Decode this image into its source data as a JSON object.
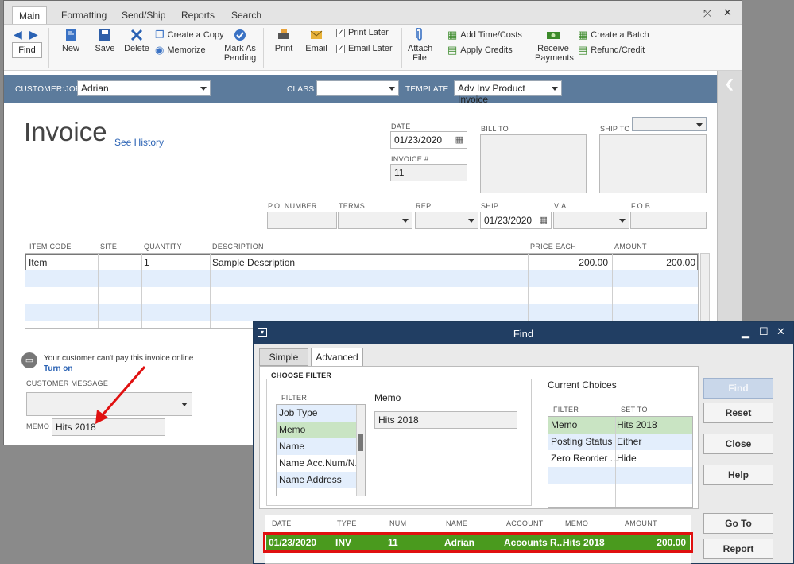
{
  "main": {
    "tabs": [
      "Main",
      "Formatting",
      "Send/Ship",
      "Reports",
      "Search"
    ],
    "ribbon": {
      "find": "Find",
      "new": "New",
      "save": "Save",
      "delete": "Delete",
      "create_copy": "Create a Copy",
      "memorize": "Memorize",
      "mark_as": "Mark As",
      "pending": "Pending",
      "print": "Print",
      "email": "Email",
      "print_later": "Print Later",
      "email_later": "Email Later",
      "attach": "Attach",
      "file": "File",
      "add_time_costs": "Add Time/Costs",
      "apply_credits": "Apply Credits",
      "receive": "Receive",
      "payments": "Payments",
      "create_batch": "Create a Batch",
      "refund_credit": "Refund/Credit"
    },
    "header": {
      "customer_job_label": "CUSTOMER:JOB",
      "customer_job_value": "Adrian",
      "class_label": "CLASS",
      "class_value": "",
      "template_label": "TEMPLATE",
      "template_value": "Adv Inv Product Invoice"
    },
    "form": {
      "title": "Invoice",
      "see_history": "See History",
      "date_label": "DATE",
      "date_value": "01/23/2020",
      "invoice_no_label": "INVOICE #",
      "invoice_no_value": "11",
      "bill_to_label": "BILL TO",
      "ship_to_label": "SHIP TO",
      "po_label": "P.O. NUMBER",
      "terms_label": "TERMS",
      "rep_label": "REP",
      "ship_label": "SHIP",
      "ship_value": "01/23/2020",
      "via_label": "VIA",
      "fob_label": "F.O.B."
    },
    "table": {
      "columns": [
        "ITEM CODE",
        "SITE",
        "QUANTITY",
        "DESCRIPTION",
        "PRICE EACH",
        "AMOUNT"
      ],
      "rows": [
        {
          "item": "Item",
          "site": "",
          "qty": "1",
          "desc": "Sample Description",
          "price": "200.00",
          "amount": "200.00"
        }
      ]
    },
    "footer": {
      "pay_notice": "Your customer can't pay this invoice online",
      "turn_on": "Turn on",
      "customer_message_label": "CUSTOMER MESSAGE",
      "memo_label": "MEMO",
      "memo_value": "Hits 2018"
    }
  },
  "find_dialog": {
    "title": "Find",
    "tabs": [
      "Simple",
      "Advanced"
    ],
    "choose_filter": "CHOOSE FILTER",
    "filter_label": "FILTER",
    "filter_items": [
      "Job Type",
      "Memo",
      "Name",
      "Name Acc.Num/N...",
      "Name Address"
    ],
    "selected_filter": "Memo",
    "memo_field_label": "Memo",
    "memo_field_value": "Hits 2018",
    "current_choices": "Current Choices",
    "cc_filter_header": "FILTER",
    "cc_setto_header": "SET TO",
    "choices": [
      {
        "filter": "Memo",
        "set_to": "Hits 2018"
      },
      {
        "filter": "Posting Status",
        "set_to": "Either"
      },
      {
        "filter": "Zero Reorder ...",
        "set_to": "Hide"
      }
    ],
    "buttons": {
      "find": "Find",
      "reset": "Reset",
      "close": "Close",
      "help": "Help",
      "goto": "Go To",
      "report": "Report"
    },
    "results_columns": [
      "DATE",
      "TYPE",
      "NUM",
      "NAME",
      "ACCOUNT",
      "MEMO",
      "AMOUNT"
    ],
    "results": [
      {
        "date": "01/23/2020",
        "type": "INV",
        "num": "11",
        "name": "Adrian",
        "account": "Accounts R...",
        "memo": "Hits 2018",
        "amount": "200.00"
      }
    ]
  },
  "colors": {
    "header_bar": "#5c7b9c",
    "dialog_title": "#213e63",
    "result_row": "#4a9a1e",
    "highlight_box": "#e01010",
    "annotation_arrow": "#e01010"
  }
}
